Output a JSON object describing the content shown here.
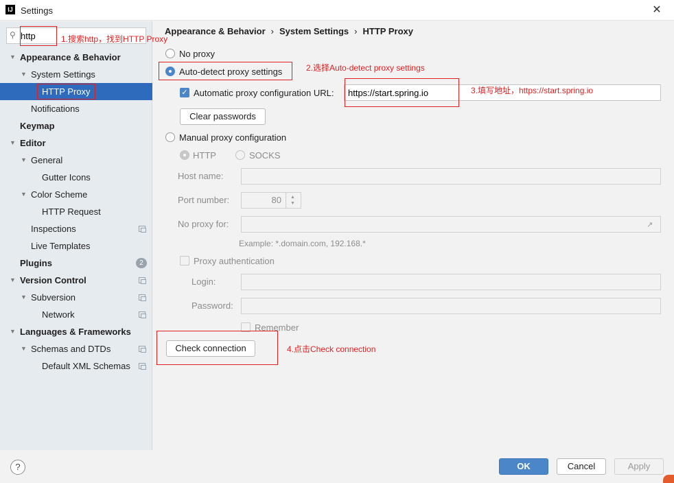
{
  "window": {
    "title": "Settings",
    "app_icon": "IJ"
  },
  "search": {
    "value": "http"
  },
  "sidebar": {
    "items": [
      {
        "label": "Appearance & Behavior",
        "bold": true,
        "expanded": true
      },
      {
        "label": "System Settings",
        "expanded": true
      },
      {
        "label": "HTTP Proxy",
        "selected": true
      },
      {
        "label": "Notifications"
      },
      {
        "label": "Keymap",
        "bold": true
      },
      {
        "label": "Editor",
        "bold": true,
        "expanded": true
      },
      {
        "label": "General",
        "expanded": true
      },
      {
        "label": "Gutter Icons"
      },
      {
        "label": "Color Scheme",
        "expanded": true
      },
      {
        "label": "HTTP Request"
      },
      {
        "label": "Inspections"
      },
      {
        "label": "Live Templates"
      },
      {
        "label": "Plugins",
        "bold": true,
        "badge": "2"
      },
      {
        "label": "Version Control",
        "bold": true,
        "expanded": true
      },
      {
        "label": "Subversion",
        "expanded": true
      },
      {
        "label": "Network"
      },
      {
        "label": "Languages & Frameworks",
        "bold": true,
        "expanded": true
      },
      {
        "label": "Schemas and DTDs",
        "expanded": true
      },
      {
        "label": "Default XML Schemas"
      }
    ]
  },
  "breadcrumb": {
    "part1": "Appearance & Behavior",
    "part2": "System Settings",
    "part3": "HTTP Proxy",
    "separator": "›"
  },
  "proxy": {
    "no_proxy_label": "No proxy",
    "auto_detect_label": "Auto-detect proxy settings",
    "auto_config_url_label": "Automatic proxy configuration URL:",
    "auto_config_url_value": "https://start.spring.io",
    "clear_passwords_label": "Clear passwords",
    "manual_label": "Manual proxy configuration",
    "http_label": "HTTP",
    "socks_label": "SOCKS",
    "host_name_label": "Host name:",
    "port_number_label": "Port number:",
    "port_value": "80",
    "no_proxy_for_label": "No proxy for:",
    "example_text": "Example: *.domain.com, 192.168.*",
    "proxy_auth_label": "Proxy authentication",
    "login_label": "Login:",
    "password_label": "Password:",
    "remember_label": "Remember",
    "check_connection_label": "Check connection"
  },
  "annotations": {
    "step1": "1.搜索http，找到HTTP Proxy",
    "step2": "2.选择Auto-detect proxy settings",
    "step3": "3.填写地址，https://start.spring.io",
    "step4": "4.点击Check connection",
    "color": "#e02020"
  },
  "footer": {
    "help": "?",
    "ok_label": "OK",
    "cancel_label": "Cancel",
    "apply_label": "Apply"
  },
  "colors": {
    "selection": "#2f6bbd",
    "primary_button": "#4a86c8",
    "sidebar_bg": "#e6ebf0"
  }
}
